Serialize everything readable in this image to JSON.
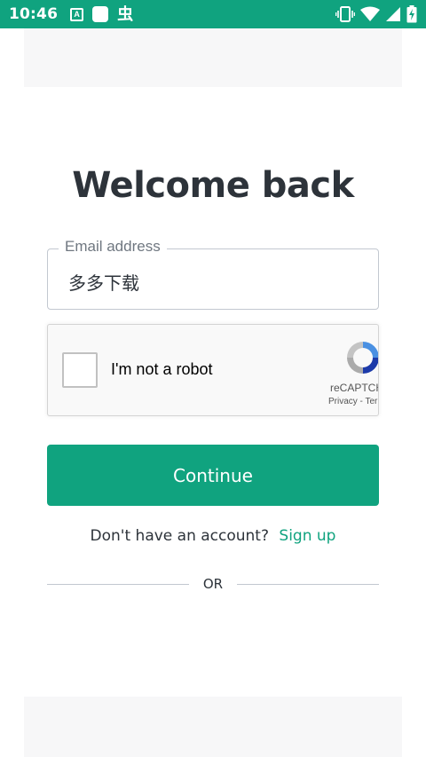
{
  "status_bar": {
    "time": "10:46",
    "left_icons": [
      "a-badge-icon",
      "square-app-icon",
      "bug-icon"
    ],
    "right_icons": [
      "vibrate-icon",
      "wifi-icon",
      "signal-icon",
      "battery-charging-icon"
    ],
    "bug_glyph": "虫",
    "a_glyph": "A"
  },
  "page": {
    "title": "Welcome back"
  },
  "email_field": {
    "label": "Email address",
    "value": "多多下载"
  },
  "recaptcha": {
    "label": "I'm not a robot",
    "brand": "reCAPTCHA",
    "links": "Privacy - Terms"
  },
  "continue_button": {
    "label": "Continue"
  },
  "signup": {
    "prompt": "Don't have an account?",
    "link": "Sign up"
  },
  "divider": {
    "text": "OR"
  },
  "colors": {
    "brand": "#10a37f",
    "text": "#2d333a",
    "border": "#c2c8d0"
  }
}
